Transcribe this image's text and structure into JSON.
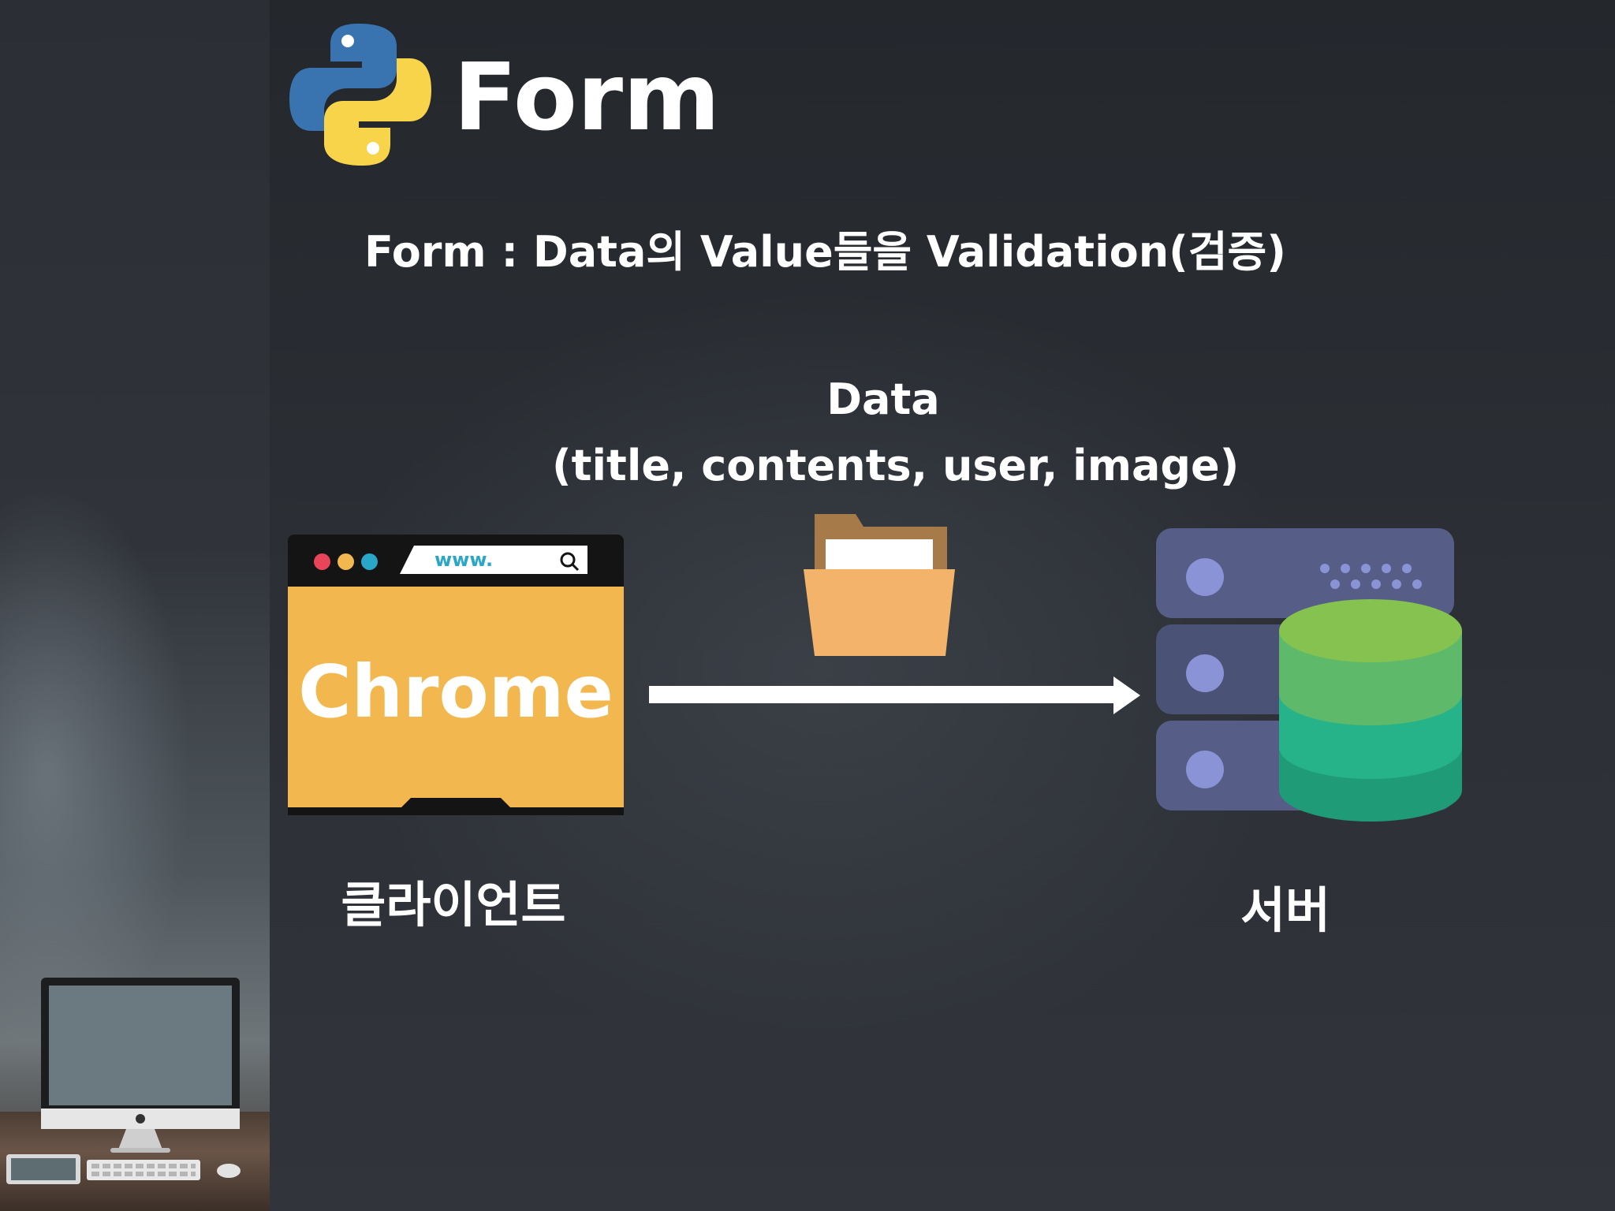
{
  "slide": {
    "title": "Form",
    "subtitle": "Form : Data의 Value들을 Validation(검증)",
    "data_label": "Data",
    "data_fields": "(title, contents, user, image)",
    "client_label": "클라이언트",
    "server_label": "서버"
  },
  "browser": {
    "url_text": "www.",
    "body_text": "Chrome",
    "dot_colors": [
      "#e8445a",
      "#f2b84f",
      "#2aa7c8"
    ],
    "body_color": "#f2b84f"
  },
  "icons": [
    "python-logo-icon",
    "search-icon",
    "folder-icon",
    "server-rack-icon",
    "database-icon",
    "arrow-right-icon",
    "imac-icon",
    "keyboard-icon",
    "tablet-icon",
    "mouse-icon"
  ]
}
